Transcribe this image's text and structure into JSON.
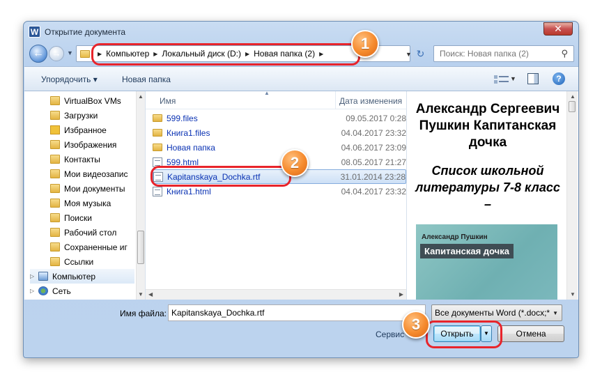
{
  "window": {
    "title": "Открытие документа",
    "app_icon_letter": "W",
    "close_glyph": "✕"
  },
  "nav": {
    "back_glyph": "←",
    "forward_glyph": "→",
    "history_glyph": "▼",
    "breadcrumb": [
      "Компьютер",
      "Локальный диск (D:)",
      "Новая папка (2)"
    ],
    "address_dropdown_glyph": "▼",
    "refresh_glyph": "↻",
    "search_placeholder": "Поиск: Новая папка (2)",
    "search_glyph": "⚲"
  },
  "toolbar": {
    "organize": "Упорядочить ▾",
    "new_folder": "Новая папка",
    "view_arrow": "▼",
    "help": "?"
  },
  "sidebar": {
    "items": [
      {
        "label": "VirtualBox VMs",
        "icon": "folder"
      },
      {
        "label": "Загрузки",
        "icon": "folder"
      },
      {
        "label": "Избранное",
        "icon": "star"
      },
      {
        "label": "Изображения",
        "icon": "folder"
      },
      {
        "label": "Контакты",
        "icon": "folder"
      },
      {
        "label": "Мои видеозапис",
        "icon": "folder"
      },
      {
        "label": "Мои документы",
        "icon": "folder"
      },
      {
        "label": "Моя музыка",
        "icon": "folder"
      },
      {
        "label": "Поиски",
        "icon": "folder"
      },
      {
        "label": "Рабочий стол",
        "icon": "folder"
      },
      {
        "label": "Сохраненные иг",
        "icon": "folder"
      },
      {
        "label": "Ссылки",
        "icon": "folder"
      },
      {
        "label": "Компьютер",
        "icon": "computer"
      },
      {
        "label": "Сеть",
        "icon": "network"
      }
    ]
  },
  "filelist": {
    "col_name": "Имя",
    "col_date": "Дата изменения",
    "rows": [
      {
        "name": "599.files",
        "date": "09.05.2017 0:28",
        "type": "folder"
      },
      {
        "name": "Книга1.files",
        "date": "04.04.2017 23:32",
        "type": "folder"
      },
      {
        "name": "Новая папка",
        "date": "04.06.2017 23:09",
        "type": "folder"
      },
      {
        "name": "599.html",
        "date": "08.05.2017 21:27",
        "type": "doc"
      },
      {
        "name": "Kapitanskaya_Dochka.rtf",
        "date": "31.01.2014 23:28",
        "type": "doc",
        "selected": true
      },
      {
        "name": "Книга1.html",
        "date": "04.04.2017 23:32",
        "type": "doc"
      }
    ]
  },
  "preview": {
    "title": "Александр Сергеевич Пушкин Капитанская дочка",
    "subtitle": "Список школьной литературы 7-8 класс –",
    "cover_author": "Александр Пушкин",
    "cover_title": "Капитанская дочка"
  },
  "bottom": {
    "filename_label": "Имя файла:",
    "filename_value": "Kapitanskaya_Dochka.rtf",
    "filter": "Все документы Word (*.docx;*",
    "service": "Сервис",
    "open": "Открыть",
    "open_dropdown": "▼",
    "cancel": "Отмена"
  },
  "callouts": [
    "1",
    "2",
    "3"
  ],
  "colors": {
    "highlight": "#e8242b",
    "badge": "#f58a2d",
    "link_blue": "#0a32b3"
  }
}
